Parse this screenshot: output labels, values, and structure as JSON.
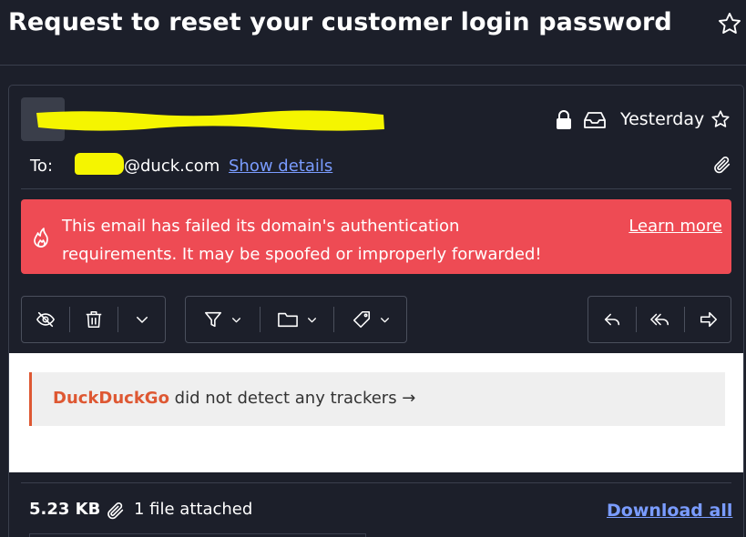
{
  "header": {
    "title": "Request to reset your customer login password"
  },
  "message": {
    "date": "Yesterday",
    "to_label": "To:",
    "recipient_domain": "@duck.com",
    "show_details": "Show details"
  },
  "alert": {
    "text": "This email has failed its domain's authentication requirements. It may be spoofed or improperly forwarded!",
    "link": "Learn more",
    "color": "#ee4b54"
  },
  "toolbar": {
    "icons": [
      "eye-slash-icon",
      "trash-icon",
      "chevron-down-icon",
      "filter-icon",
      "folder-icon",
      "tag-icon",
      "reply-icon",
      "reply-all-icon",
      "forward-icon"
    ]
  },
  "tracker": {
    "brand": "DuckDuckGo",
    "text": "did not detect any trackers →",
    "brand_color": "#de5833"
  },
  "attachments": {
    "size": "5.23 KB",
    "count_text": "1 file attached",
    "download_all": "Download all"
  },
  "colors": {
    "background": "#1c1f2a",
    "link": "#7a9cff",
    "redaction": "#f5f500"
  }
}
